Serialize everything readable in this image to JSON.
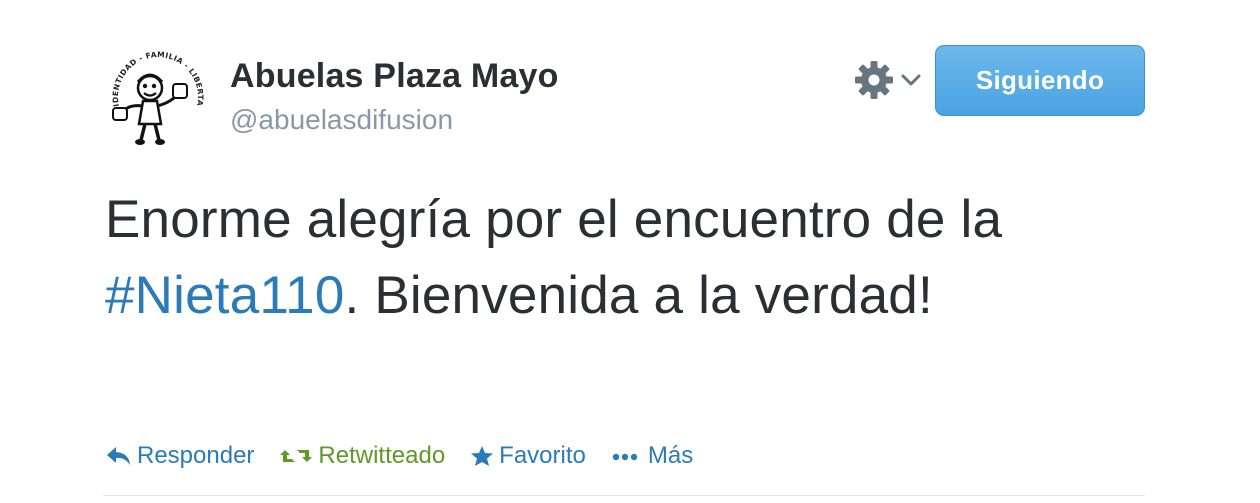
{
  "user": {
    "fullname": "Abuelas Plaza Mayo",
    "screen_name": "@abuelasdifusion",
    "avatar_ring_text": "IDENTIDAD - FAMILIA - LIBERTAD",
    "avatar_icon": "abuelas-logo"
  },
  "header": {
    "gear_icon": "gear-icon",
    "dropdown_icon": "chevron-down-icon",
    "follow_label": "Siguiendo"
  },
  "tweet": {
    "text_part1": "Enorme alegría por el encuentro de la ",
    "hashtag": "#Nieta110",
    "text_part2": ". Bienvenida a la verdad!"
  },
  "actions": {
    "reply": "Responder",
    "retweet": "Retwitteado",
    "favorite": "Favorito",
    "more": "Más"
  },
  "colors": {
    "link": "#2b7bb9",
    "retweeted": "#609928",
    "follow_button": "#55acee",
    "muted": "#8899a6",
    "text": "#292f33"
  }
}
